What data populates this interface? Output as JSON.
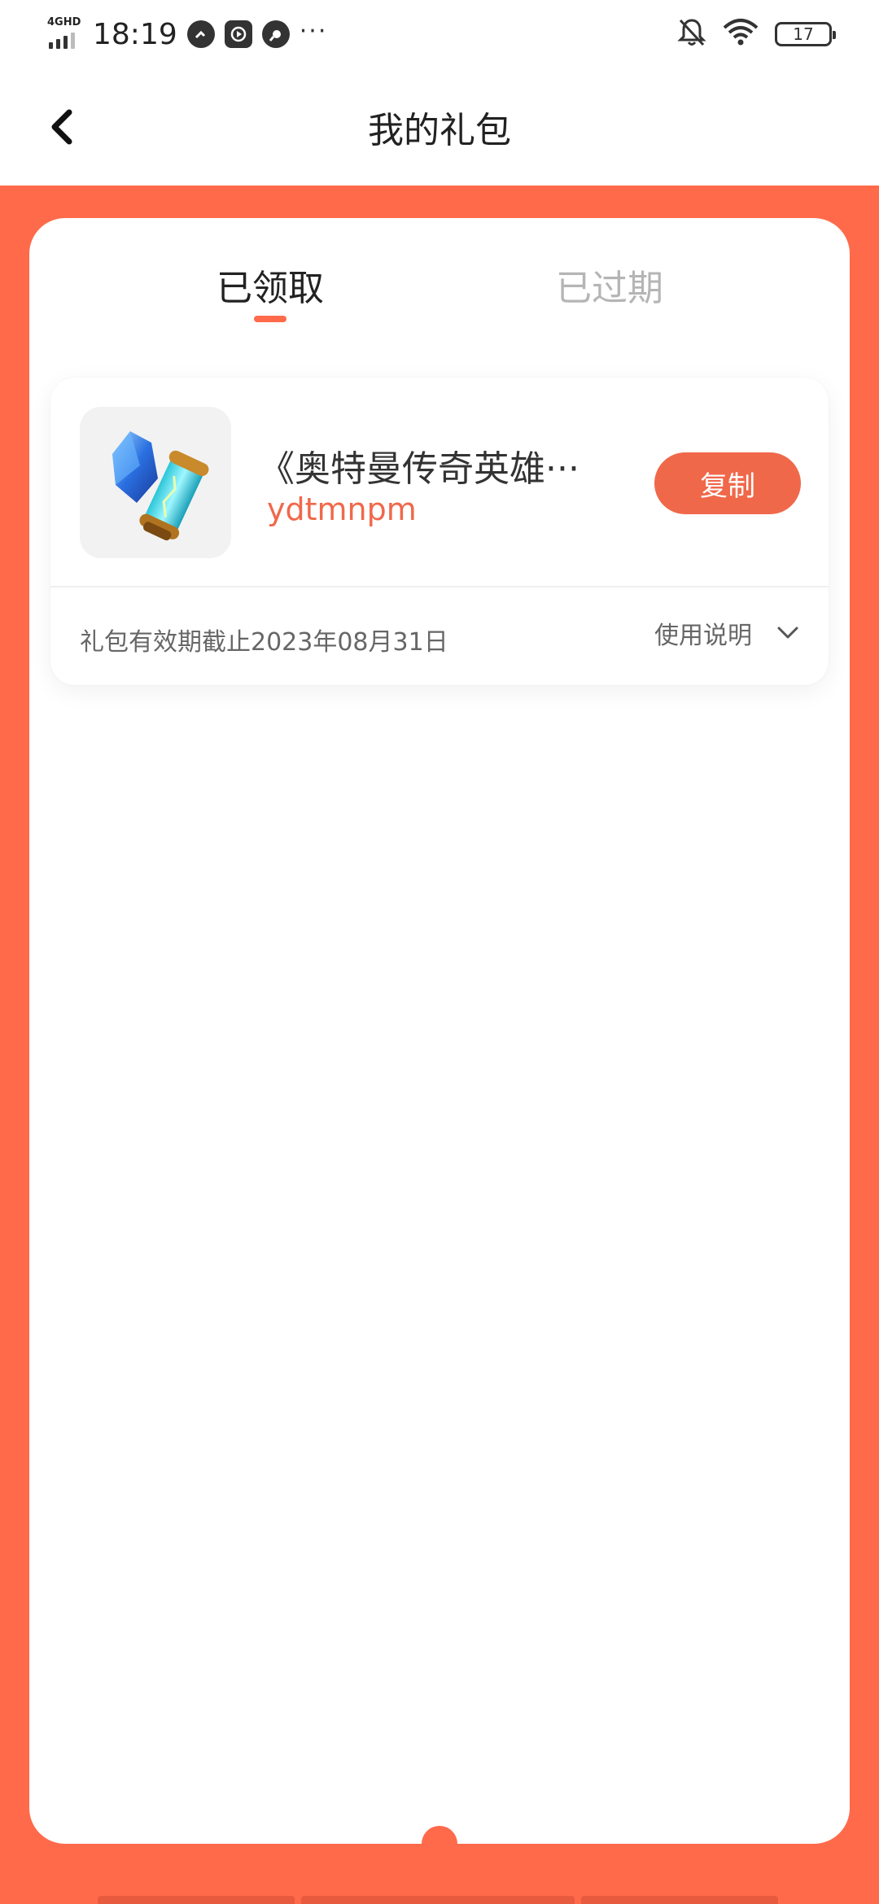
{
  "status_bar": {
    "network": "4GHD",
    "time": "18:19",
    "more": "···",
    "battery": "17"
  },
  "nav": {
    "title": "我的礼包"
  },
  "tabs": [
    {
      "label": "已领取",
      "active": true
    },
    {
      "label": "已过期",
      "active": false
    }
  ],
  "gift": {
    "name": "《奥特曼传奇英雄···",
    "code": "ydtmnpm",
    "copy_label": "复制",
    "validity": "礼包有效期截止2023年08月31日",
    "usage_label": "使用说明"
  },
  "colors": {
    "accent": "#ff6a4b",
    "button": "#f0684a",
    "inactive_tab": "#b5b5b5"
  }
}
